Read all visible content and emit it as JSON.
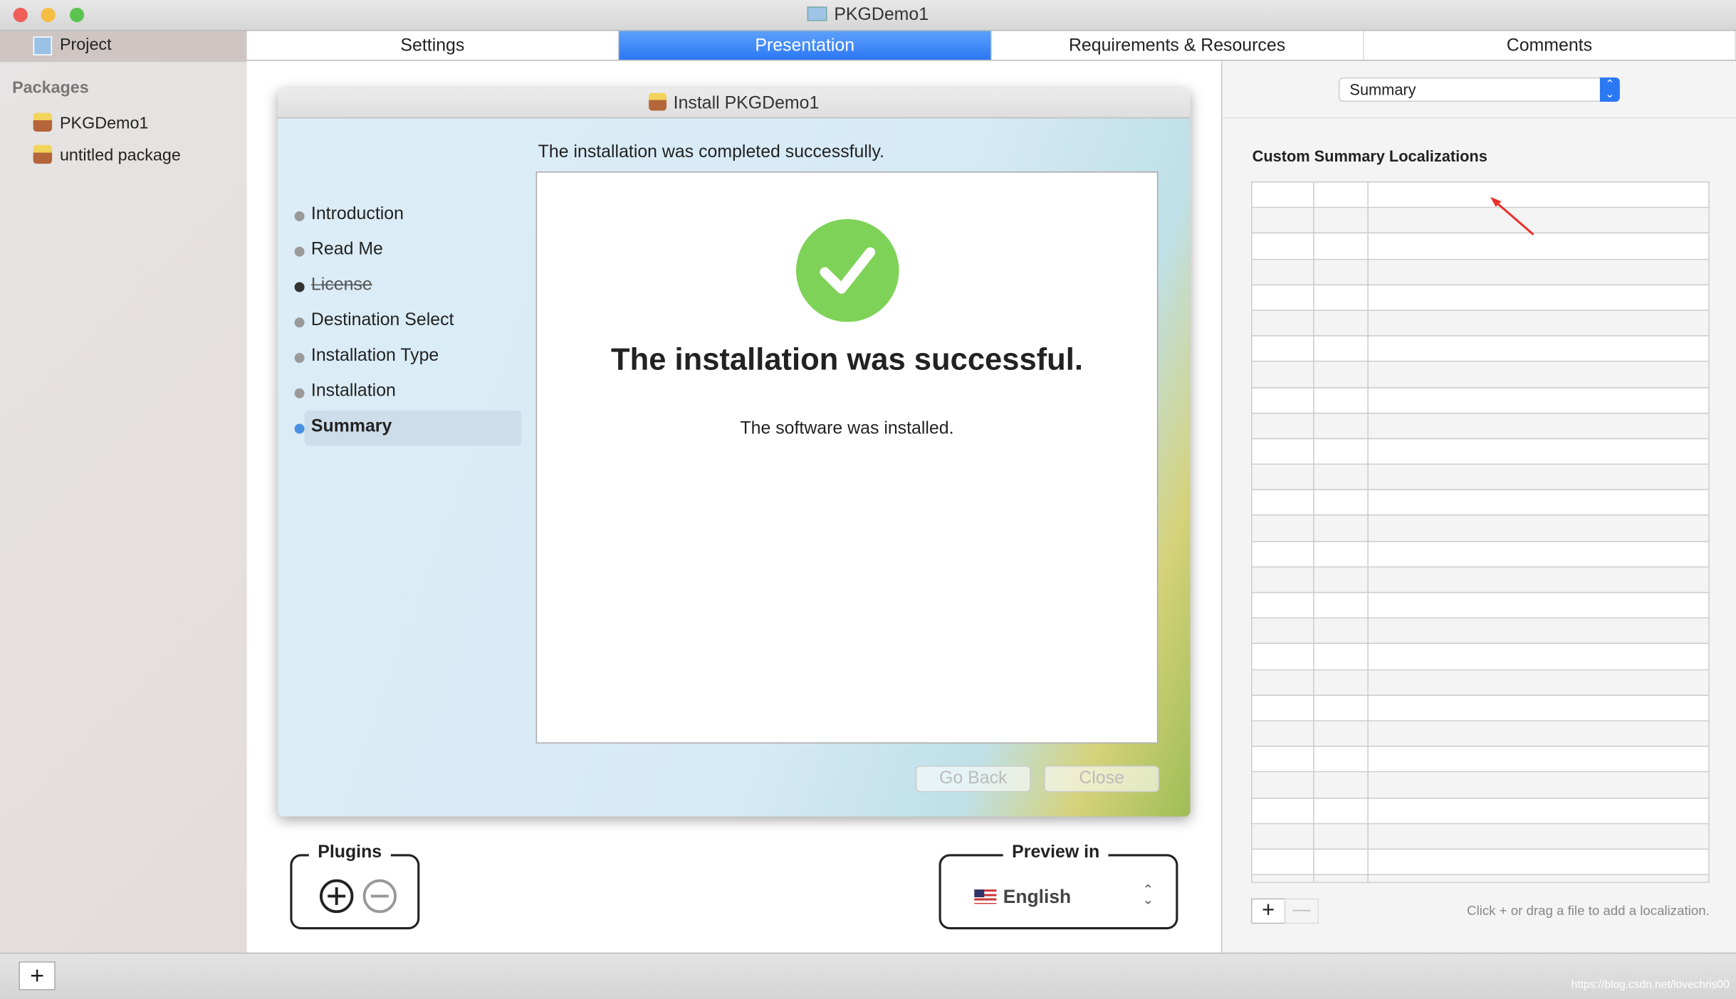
{
  "window": {
    "title": "PKGDemo1"
  },
  "sidebar": {
    "project_label": "Project",
    "section": "Packages",
    "packages": [
      {
        "label": "PKGDemo1"
      },
      {
        "label": "untitled package"
      }
    ]
  },
  "tabs": [
    {
      "label": "Settings"
    },
    {
      "label": "Presentation",
      "active": true
    },
    {
      "label": "Requirements & Resources"
    },
    {
      "label": "Comments"
    }
  ],
  "installer": {
    "title": "Install PKGDemo1",
    "header": "The installation was completed successfully.",
    "steps": [
      {
        "label": "Introduction"
      },
      {
        "label": "Read Me"
      },
      {
        "label": "License",
        "disabled": true
      },
      {
        "label": "Destination Select"
      },
      {
        "label": "Installation Type"
      },
      {
        "label": "Installation"
      },
      {
        "label": "Summary",
        "active": true
      }
    ],
    "success_title": "The installation was successful.",
    "success_message": "The software was installed.",
    "go_back": "Go Back",
    "close": "Close"
  },
  "plugins": {
    "label": "Plugins"
  },
  "preview": {
    "label": "Preview in",
    "language": "English"
  },
  "right": {
    "dropdown": "Summary",
    "section_title": "Custom Summary Localizations",
    "hint": "Click + or drag a file to add a localization."
  },
  "watermark": "https://blog.csdn.net/lovechris00",
  "colors": {
    "accent": "#2b78f4",
    "success": "#7ed257",
    "arrow": "#e8322f"
  }
}
